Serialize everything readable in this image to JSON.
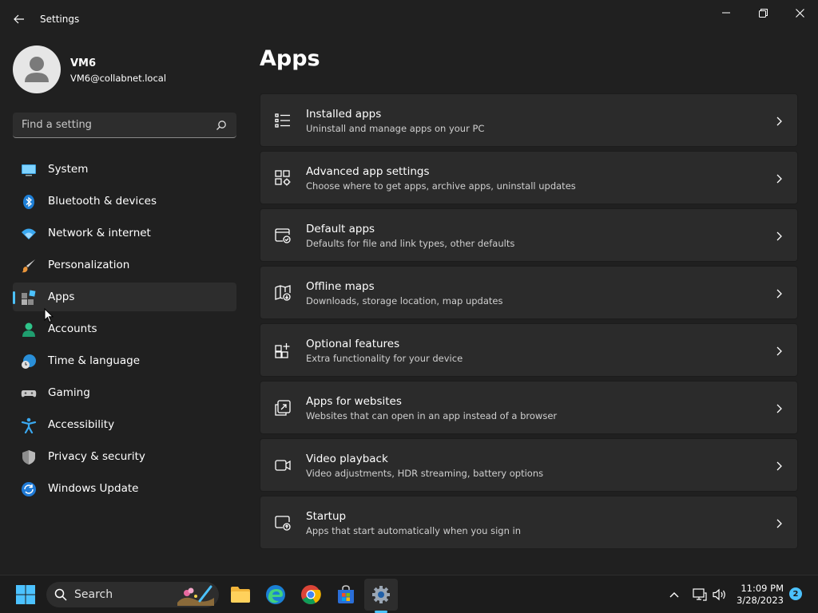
{
  "window": {
    "title": "Settings",
    "back_icon": "back-arrow-icon",
    "minimize_icon": "minimize-icon",
    "maximize_icon": "restore-icon",
    "close_icon": "close-icon"
  },
  "user": {
    "name": "VM6",
    "email": "VM6@collabnet.local"
  },
  "search": {
    "placeholder": "Find a setting"
  },
  "sidebar": {
    "items": [
      {
        "label": "System",
        "icon": "monitor-icon",
        "active": false
      },
      {
        "label": "Bluetooth & devices",
        "icon": "bluetooth-icon",
        "active": false
      },
      {
        "label": "Network & internet",
        "icon": "wifi-icon",
        "active": false
      },
      {
        "label": "Personalization",
        "icon": "paintbrush-icon",
        "active": false
      },
      {
        "label": "Apps",
        "icon": "apps-icon",
        "active": true
      },
      {
        "label": "Accounts",
        "icon": "person-icon",
        "active": false
      },
      {
        "label": "Time & language",
        "icon": "globe-clock-icon",
        "active": false
      },
      {
        "label": "Gaming",
        "icon": "gamepad-icon",
        "active": false
      },
      {
        "label": "Accessibility",
        "icon": "accessibility-icon",
        "active": false
      },
      {
        "label": "Privacy & security",
        "icon": "shield-icon",
        "active": false
      },
      {
        "label": "Windows Update",
        "icon": "update-icon",
        "active": false
      }
    ]
  },
  "main": {
    "title": "Apps",
    "cards": [
      {
        "title": "Installed apps",
        "subtitle": "Uninstall and manage apps on your PC",
        "icon": "list-icon"
      },
      {
        "title": "Advanced app settings",
        "subtitle": "Choose where to get apps, archive apps, uninstall updates",
        "icon": "app-settings-icon"
      },
      {
        "title": "Default apps",
        "subtitle": "Defaults for file and link types, other defaults",
        "icon": "default-apps-icon"
      },
      {
        "title": "Offline maps",
        "subtitle": "Downloads, storage location, map updates",
        "icon": "map-download-icon"
      },
      {
        "title": "Optional features",
        "subtitle": "Extra functionality for your device",
        "icon": "add-grid-icon"
      },
      {
        "title": "Apps for websites",
        "subtitle": "Websites that can open in an app instead of a browser",
        "icon": "open-in-app-icon"
      },
      {
        "title": "Video playback",
        "subtitle": "Video adjustments, HDR streaming, battery options",
        "icon": "video-icon"
      },
      {
        "title": "Startup",
        "subtitle": "Apps that start automatically when you sign in",
        "icon": "startup-icon"
      }
    ]
  },
  "taskbar": {
    "search_label": "Search",
    "time": "11:09 PM",
    "date": "3/28/2023",
    "notification_count": "2"
  },
  "colors": {
    "accent": "#4cc2ff",
    "background": "#202020",
    "card": "#2b2b2b"
  }
}
